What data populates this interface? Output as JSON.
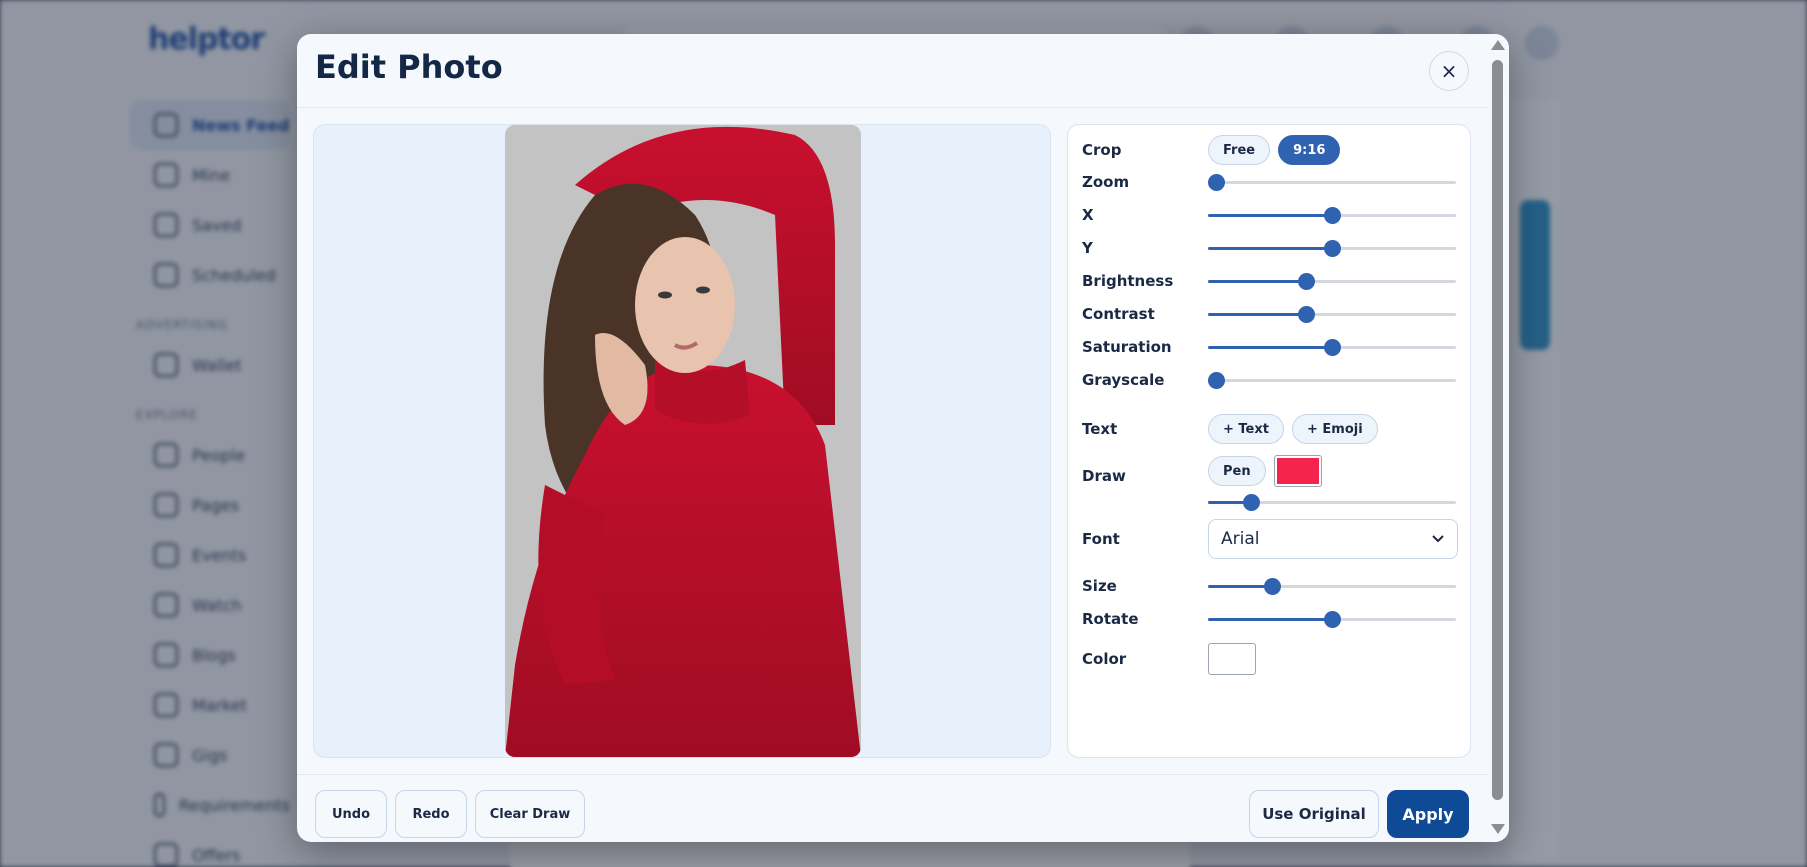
{
  "background": {
    "logo": "helptor",
    "sidebar": [
      {
        "label": "News Feed",
        "active": true
      },
      {
        "label": "Mine"
      },
      {
        "label": "Saved"
      },
      {
        "label": "Scheduled"
      },
      {
        "section": "ADVERTISING"
      },
      {
        "label": "Wallet"
      },
      {
        "section": "EXPLORE"
      },
      {
        "label": "People"
      },
      {
        "label": "Pages"
      },
      {
        "label": "Events"
      },
      {
        "label": "Watch"
      },
      {
        "label": "Blogs"
      },
      {
        "label": "Market"
      },
      {
        "label": "Gigs"
      },
      {
        "label": "Requirements"
      },
      {
        "label": "Offers"
      }
    ]
  },
  "modal": {
    "title": "Edit Photo",
    "close_label": "×",
    "controls": {
      "crop": {
        "label": "Crop",
        "options": [
          "Free",
          "9:16"
        ],
        "selected": "9:16"
      },
      "zoom": {
        "label": "Zoom",
        "value": 0
      },
      "x": {
        "label": "X",
        "value": 0.5
      },
      "y": {
        "label": "Y",
        "value": 0.5
      },
      "brightness": {
        "label": "Brightness",
        "value": 0.39
      },
      "contrast": {
        "label": "Contrast",
        "value": 0.39
      },
      "saturation": {
        "label": "Saturation",
        "value": 0.5
      },
      "grayscale": {
        "label": "Grayscale",
        "value": 0
      },
      "text": {
        "label": "Text",
        "add_text": "+ Text",
        "add_emoji": "+ Emoji"
      },
      "draw": {
        "label": "Draw",
        "pen": "Pen",
        "color": "#f5244f",
        "width": 0.15
      },
      "font": {
        "label": "Font",
        "value": "Arial"
      },
      "size": {
        "label": "Size",
        "value": 0.24
      },
      "rotate": {
        "label": "Rotate",
        "value": 0.5
      },
      "color": {
        "label": "Color",
        "value": "#ffffff"
      }
    },
    "footer": {
      "undo": "Undo",
      "redo": "Redo",
      "clear_draw": "Clear Draw",
      "use_original": "Use Original",
      "apply": "Apply"
    }
  },
  "colors": {
    "accent": "#2f62b1",
    "primary_button": "#0f4a96",
    "title": "#142846"
  }
}
